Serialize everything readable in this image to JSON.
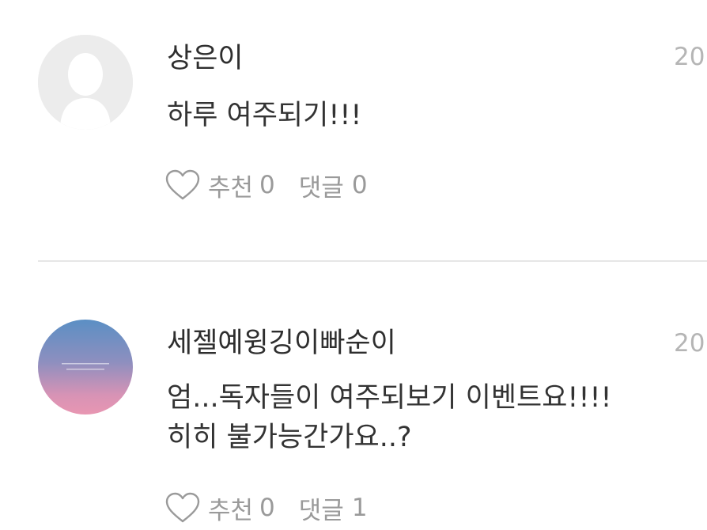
{
  "comments": [
    {
      "username": "상은이",
      "date": "20",
      "text": "하루 여주되기!!!",
      "like_label": "추천",
      "like_count": "0",
      "reply_label": "댓글",
      "reply_count": "0",
      "avatar": "default-profile-icon"
    },
    {
      "username": "세젤예윙깅이빠순이",
      "date": "20",
      "text": "엄...독자들이 여주되보기 이벤트요!!!!\n히히 불가능간가요..?",
      "like_label": "추천",
      "like_count": "0",
      "reply_label": "댓글",
      "reply_count": "1",
      "avatar": "gradient-photo"
    }
  ],
  "colors": {
    "username": "#2e2e2e",
    "text": "#333333",
    "meta": "#9a9a9a",
    "date": "#b5b5b5",
    "divider": "#e6e6e6"
  }
}
